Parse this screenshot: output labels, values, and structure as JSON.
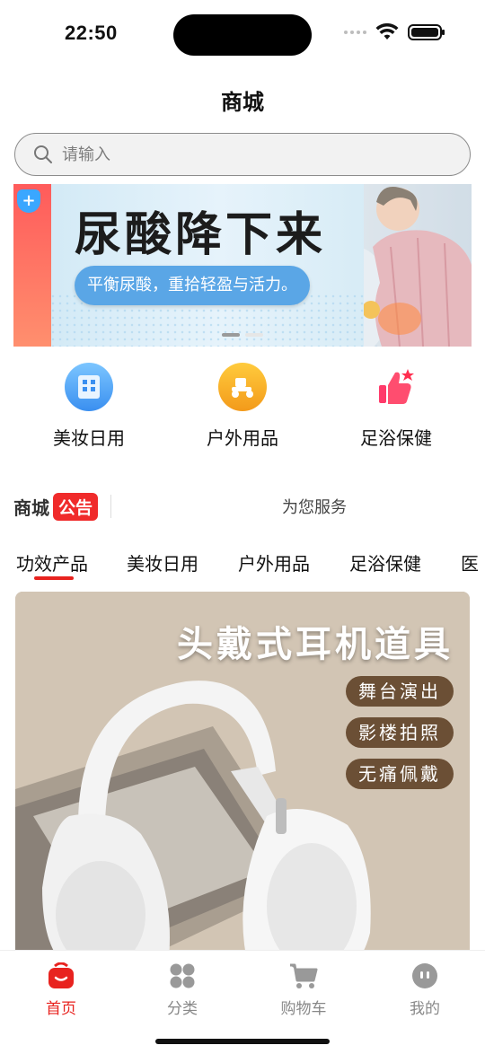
{
  "status_bar": {
    "time": "22:50"
  },
  "header": {
    "title": "商城"
  },
  "search": {
    "placeholder": "请输入"
  },
  "banner": {
    "headline": "尿酸降下来",
    "subtitle": "平衡尿酸，重拾轻盈与活力。"
  },
  "categories": [
    {
      "label": "美妆日用",
      "icon": "building-icon",
      "color": "#4aa8f5"
    },
    {
      "label": "户外用品",
      "icon": "scooter-icon",
      "color": "#f7a824"
    },
    {
      "label": "足浴保健",
      "icon": "thumbs-up-icon",
      "color": "#ff4a6e"
    }
  ],
  "notice": {
    "brand": "商城",
    "tag": "公告",
    "text": "为您服务"
  },
  "tabs": [
    {
      "label": "功效产品"
    },
    {
      "label": "美妆日用"
    },
    {
      "label": "户外用品"
    },
    {
      "label": "足浴保健"
    },
    {
      "label": "医"
    }
  ],
  "product": {
    "title": "头戴式耳机道具",
    "chips": [
      "舞台演出",
      "影楼拍照",
      "无痛佩戴"
    ]
  },
  "tabbar": [
    {
      "label": "首页",
      "icon": "home-icon",
      "active": true
    },
    {
      "label": "分类",
      "icon": "grid-icon",
      "active": false
    },
    {
      "label": "购物车",
      "icon": "cart-icon",
      "active": false
    },
    {
      "label": "我的",
      "icon": "profile-icon",
      "active": false
    }
  ],
  "colors": {
    "accent": "#e8231f",
    "inactive": "#888888"
  }
}
